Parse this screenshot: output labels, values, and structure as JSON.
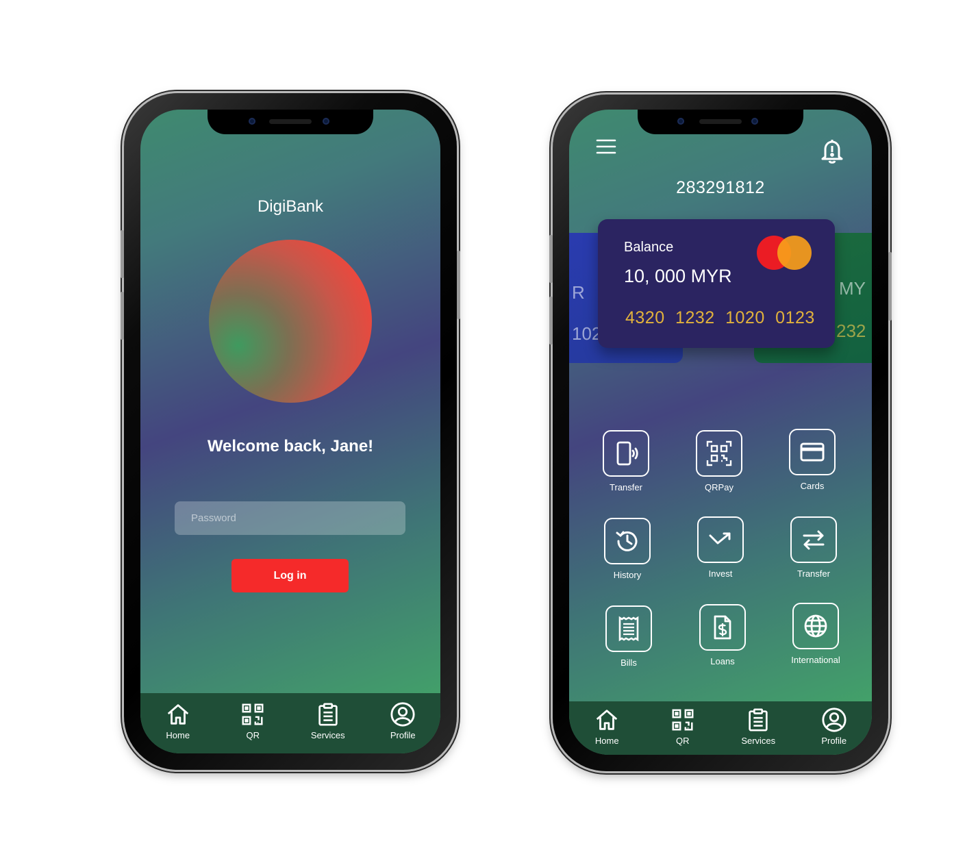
{
  "login_screen": {
    "brand": "DigiBank",
    "welcome": "Welcome back, Jane!",
    "password_placeholder": "Password",
    "login_label": "Log in"
  },
  "dashboard": {
    "account_number": "283291812",
    "card": {
      "balance_label": "Balance",
      "balance_value": "10, 000 MYR",
      "card_number": "4320 1232 1020 0123"
    },
    "side_cards": {
      "left_fragment_a": "R",
      "left_fragment_b": "102",
      "right_fragment_a": "MY",
      "right_fragment_b": "232"
    },
    "services": [
      {
        "label": "Transfer",
        "icon": "phone-wave-icon"
      },
      {
        "label": "QRPay",
        "icon": "qr-code-icon"
      },
      {
        "label": "Cards",
        "icon": "credit-card-icon"
      },
      {
        "label": "History",
        "icon": "history-icon"
      },
      {
        "label": "Invest",
        "icon": "trend-icon"
      },
      {
        "label": "Transfer",
        "icon": "swap-arrows-icon"
      },
      {
        "label": "Bills",
        "icon": "receipt-icon"
      },
      {
        "label": "Loans",
        "icon": "dollar-document-icon"
      },
      {
        "label": "International",
        "icon": "globe-icon"
      }
    ]
  },
  "nav": {
    "home": "Home",
    "qr": "QR",
    "services": "Services",
    "profile": "Profile"
  },
  "colors": {
    "accent_red": "#f52a2a",
    "card_bg": "#2b2461",
    "card_number": "#e2b23c",
    "nav_bg": "#1f4e37"
  }
}
